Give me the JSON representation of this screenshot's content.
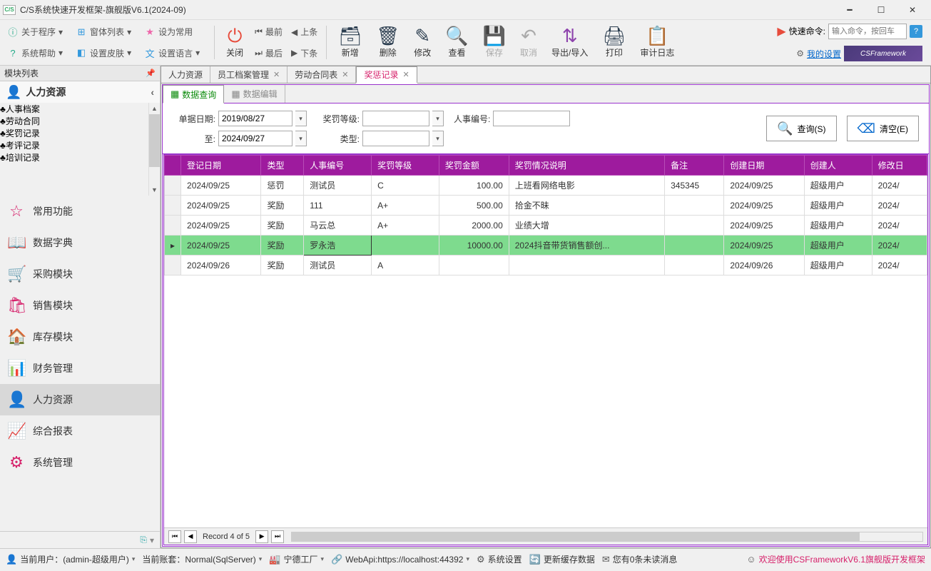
{
  "window": {
    "title": "C/S系统快速开发框架-旗舰版V6.1(2024-09)"
  },
  "menu": {
    "about": "关于程序",
    "formlist": "窗体列表",
    "setdefault": "设为常用",
    "syshelp": "系统帮助",
    "setskin": "设置皮肤",
    "setlang": "设置语言"
  },
  "toolbar": {
    "close": "关闭",
    "first": "最前",
    "prev": "上条",
    "last": "最后",
    "next": "下条",
    "add": "新增",
    "delete": "删除",
    "edit": "修改",
    "view": "查看",
    "save": "保存",
    "cancel": "取消",
    "importexport": "导出/导入",
    "print": "打印",
    "auditlog": "审计日志"
  },
  "cmd": {
    "label": "快速命令:",
    "placeholder": "输入命令，按回车",
    "settings": "我的设置",
    "logo": "CSFramework"
  },
  "sidebar": {
    "header": "模块列表",
    "moduleTitle": "人力资源",
    "tree": [
      "人事档案",
      "劳动合同",
      "奖罚记录",
      "考评记录",
      "培训记录"
    ],
    "treeActiveIndex": 2,
    "modules": [
      "常用功能",
      "数据字典",
      "采购模块",
      "销售模块",
      "库存模块",
      "财务管理",
      "人力资源",
      "综合报表",
      "系统管理"
    ],
    "modulesSelIndex": 6
  },
  "tabs": {
    "items": [
      "人力资源",
      "员工档案管理",
      "劳动合同表",
      "奖惩记录"
    ],
    "activeIndex": 3
  },
  "subtabs": {
    "query": "数据查询",
    "edit": "数据编辑"
  },
  "filters": {
    "dateLabel": "单据日期:",
    "dateFrom": "2019/08/27",
    "toLabel": "至:",
    "dateTo": "2024/09/27",
    "levelLabel": "奖罚等级:",
    "typeLabel": "类型:",
    "hrnoLabel": "人事编号:",
    "queryBtn": "查询(S)",
    "clearBtn": "清空(E)"
  },
  "grid": {
    "columns": [
      "登记日期",
      "类型",
      "人事编号",
      "奖罚等级",
      "奖罚金额",
      "奖罚情况说明",
      "备注",
      "创建日期",
      "创建人",
      "修改日"
    ],
    "rows": [
      {
        "date": "2024/09/25",
        "type": "惩罚",
        "hrno": "测试员",
        "level": "C",
        "amount": "100.00",
        "desc": "上班看网络电影",
        "memo": "345345",
        "cdate": "2024/09/25",
        "creator": "超级用户",
        "mdate": "2024/"
      },
      {
        "date": "2024/09/25",
        "type": "奖励",
        "hrno": "111",
        "level": "A+",
        "amount": "500.00",
        "desc": "拾金不昧",
        "memo": "",
        "cdate": "2024/09/25",
        "creator": "超级用户",
        "mdate": "2024/"
      },
      {
        "date": "2024/09/25",
        "type": "奖励",
        "hrno": "马云总",
        "level": "A+",
        "amount": "2000.00",
        "desc": "业绩大增",
        "memo": "",
        "cdate": "2024/09/25",
        "creator": "超级用户",
        "mdate": "2024/"
      },
      {
        "date": "2024/09/25",
        "type": "奖励",
        "hrno": "罗永浩",
        "level": "",
        "amount": "10000.00",
        "desc": "2024抖音带货销售额创...",
        "memo": "",
        "cdate": "2024/09/25",
        "creator": "超级用户",
        "mdate": "2024/"
      },
      {
        "date": "2024/09/26",
        "type": "奖励",
        "hrno": "测试员",
        "level": "A",
        "amount": "",
        "desc": "",
        "memo": "",
        "cdate": "2024/09/26",
        "creator": "超级用户",
        "mdate": "2024/"
      }
    ],
    "selectedIndex": 3,
    "pager": "Record 4 of 5"
  },
  "status": {
    "user": "当前用户：(admin-超级用户)",
    "account": "当前账套：Normal(SqlServer)",
    "factory": "宁德工厂",
    "webapi": "WebApi:https://localhost:44392",
    "syssetting": "系统设置",
    "cache": "更新缓存数据",
    "msg": "您有0条未读消息",
    "welcome": "欢迎使用CSFrameworkV6.1旗舰版开发框架"
  }
}
